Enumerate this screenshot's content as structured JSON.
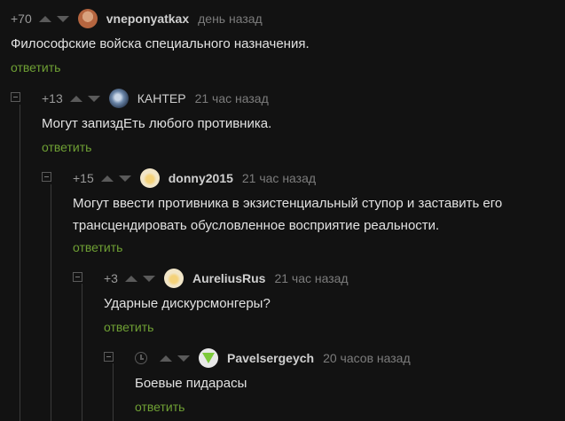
{
  "comments": [
    {
      "rating": "+70",
      "username": "vneponyatkax",
      "time": "день назад",
      "text": "Философские войска специального назначения.",
      "reply": "ответить",
      "avatar_color": "#b5653f"
    },
    {
      "rating": "+13",
      "username": "КАНТЕР",
      "time": "21 час назад",
      "text": "Могут запиздЕть любого противника.",
      "reply": "ответить",
      "avatar_color": "#6b86a8"
    },
    {
      "rating": "+15",
      "username": "donny2015",
      "time": "21 час назад",
      "text": "Могут ввести противника в экзистенциальный ступор и заставить его трансцендировать обусловленное восприятие реальности.",
      "reply": "ответить",
      "avatar_color": "#f2e6c8"
    },
    {
      "rating": "+3",
      "username": "AureliusRus",
      "time": "21 час назад",
      "text": "Ударные дискурсмонгеры?",
      "reply": "ответить",
      "avatar_color": "#f2e6c8"
    },
    {
      "rating": "",
      "username": "Pavelsergeych",
      "time": "20 часов назад",
      "text": "Боевые пидарасы",
      "reply": "ответить",
      "avatar_color": "#e8e8e8"
    }
  ],
  "icons": {
    "clock": "clock-icon",
    "collapse": "collapse-icon",
    "upvote": "upvote-arrow-icon",
    "downvote": "downvote-arrow-icon"
  },
  "colors": {
    "background": "#121212",
    "reply_link": "#6fa034",
    "username": "#cfcfcf",
    "meta": "#7c7c7c"
  }
}
